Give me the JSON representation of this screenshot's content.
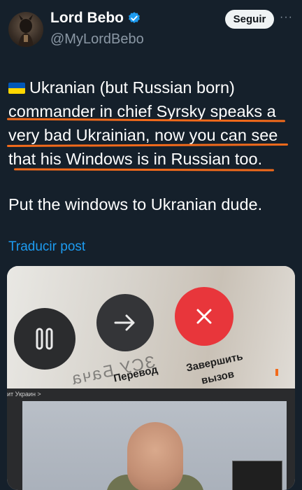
{
  "header": {
    "display_name": "Lord Bebo",
    "handle": "@MyLordBebo",
    "follow_label": "Seguir",
    "more_label": "···"
  },
  "tweet": {
    "lines": [
      "Ukranian (but Russian born)",
      "commander in chief Syrsky speaks a",
      "very bad Ukrainian, now you can see",
      "that his Windows is in Russian too."
    ],
    "line2": "Put the windows to Ukranian dude.",
    "translate_label": "Traducir post",
    "flag_icon": "ukraine-flag-icon"
  },
  "media": {
    "label_forward": "Перевод",
    "label_end_line1": "Завершить",
    "label_end_line2": "вызов",
    "mirrored_text": "ЗСУ Бача",
    "breadcrumb": "ит Украин >"
  },
  "colors": {
    "background": "#15202b",
    "accent": "#1d9bf0",
    "underline": "#f26a1b",
    "end_call": "#e8363b"
  }
}
